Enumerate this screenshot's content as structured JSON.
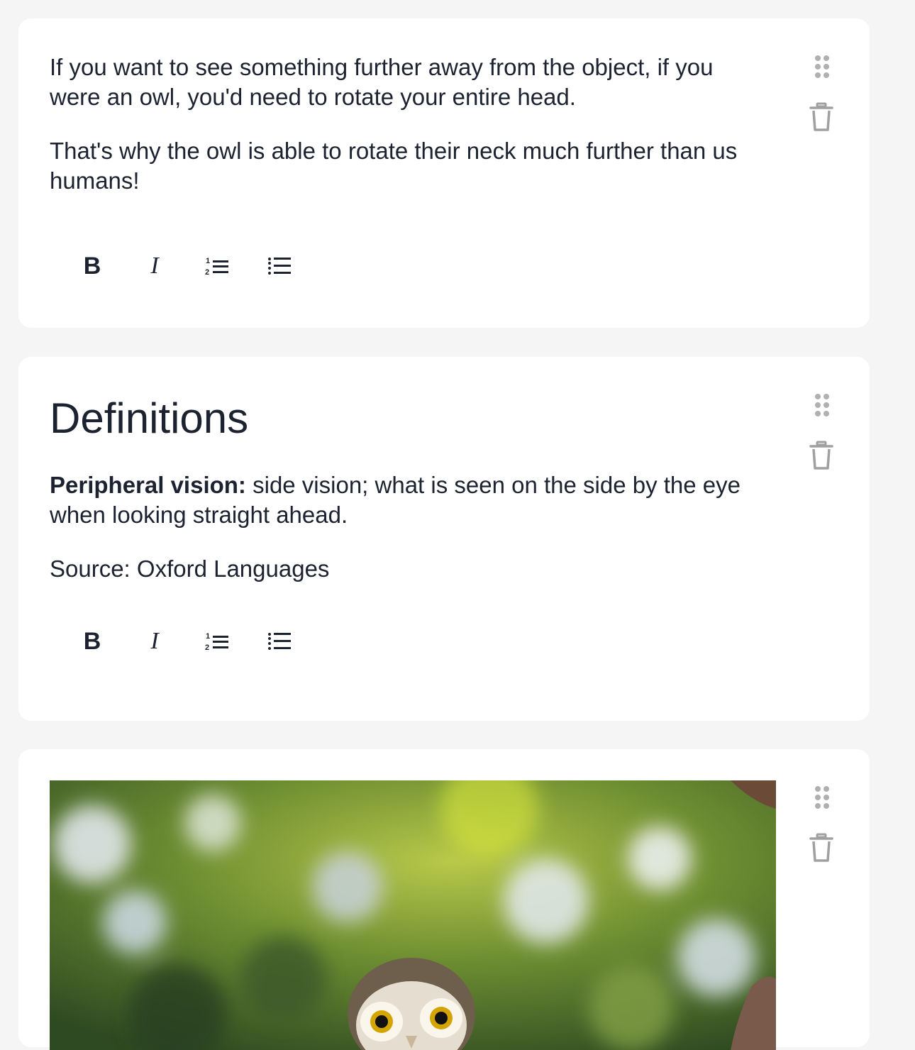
{
  "blocks": [
    {
      "type": "text",
      "paragraphs": [
        "If you want to see something further away from the object, if you were an owl, you'd need to rotate your entire head.",
        "That's why the owl is able to rotate their neck much further than us humans!"
      ]
    },
    {
      "type": "text",
      "heading": "Definitions",
      "definition_term": "Peripheral vision:",
      "definition_text": " side vision; what is seen on the side by the eye when looking straight ahead.",
      "source": "Source: Oxford Languages"
    },
    {
      "type": "image"
    }
  ],
  "toolbar": {
    "bold_label": "B",
    "italic_label": "I",
    "ordered_list_icon": "ordered-list-icon",
    "unordered_list_icon": "unordered-list-icon"
  },
  "icons": {
    "drag": "drag-handle-icon",
    "delete": "trash-icon"
  },
  "colors": {
    "background": "#f5f5f5",
    "card": "#ffffff",
    "text": "#1c2230",
    "icon_muted": "#a0a0a0"
  }
}
